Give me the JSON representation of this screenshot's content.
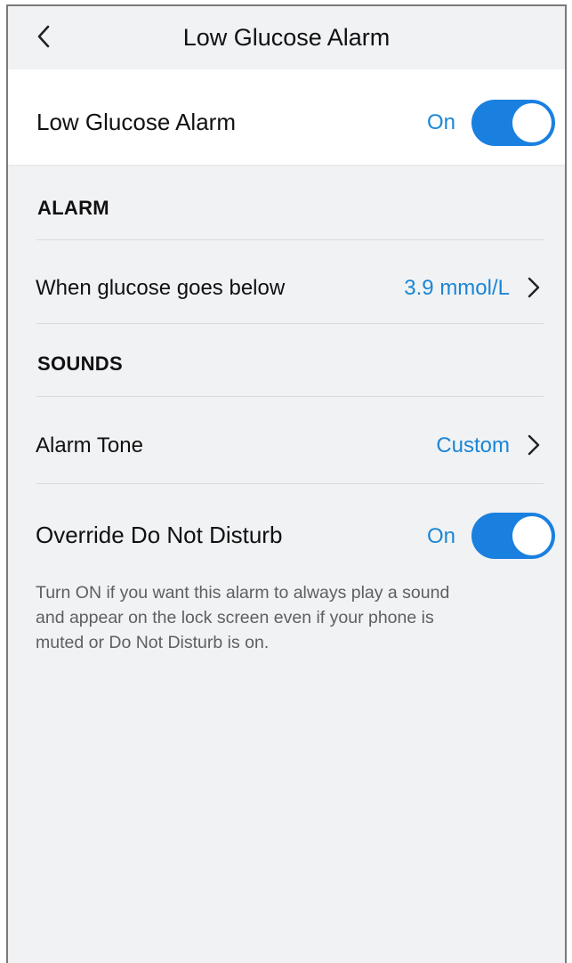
{
  "header": {
    "title": "Low Glucose Alarm",
    "back_icon": "chevron-left-icon"
  },
  "main_toggle": {
    "label": "Low Glucose Alarm",
    "state_text": "On",
    "enabled": true
  },
  "alarm_section": {
    "heading": "ALARM",
    "threshold": {
      "label": "When glucose goes below",
      "value": "3.9 mmol/L"
    }
  },
  "sounds_section": {
    "heading": "SOUNDS",
    "tone": {
      "label": "Alarm Tone",
      "value": "Custom"
    },
    "dnd": {
      "label": "Override Do Not Disturb",
      "state_text": "On",
      "enabled": true
    },
    "helper_text": "Turn ON if you want this alarm to always play a sound and appear on the lock screen even if your phone is muted or Do Not Disturb is on."
  },
  "colors": {
    "accent": "#1a80e0",
    "accent_text": "#1a86d6",
    "background": "#f1f2f4",
    "card": "#ffffff"
  }
}
